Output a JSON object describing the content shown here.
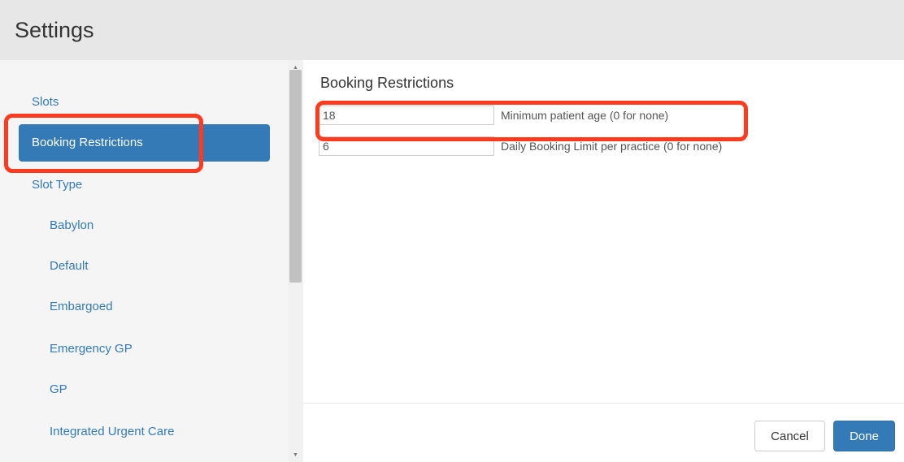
{
  "window": {
    "title": "Settings"
  },
  "sidebar": {
    "items": [
      {
        "label": "Slots"
      },
      {
        "label": "Booking Restrictions"
      },
      {
        "label": "Slot Type"
      },
      {
        "label": "Babylon"
      },
      {
        "label": "Default"
      },
      {
        "label": "Embargoed"
      },
      {
        "label": "Emergency GP"
      },
      {
        "label": "GP"
      },
      {
        "label": "Integrated Urgent Care"
      }
    ],
    "active_item": "Booking Restrictions"
  },
  "main": {
    "section_title": "Booking Restrictions",
    "fields": [
      {
        "value": "18",
        "label": "Minimum patient age (0 for none)"
      },
      {
        "value": "6",
        "label": "Daily Booking Limit per practice (0 for none)"
      }
    ]
  },
  "footer": {
    "cancel_label": "Cancel",
    "done_label": "Done"
  },
  "colors": {
    "accent": "#337ab7",
    "highlight": "#ff3a1f",
    "header_bg": "#e7e7e7",
    "sidebar_bg": "#f5f5f5"
  },
  "icons": {
    "scroll_up": "scroll-up-arrow-icon",
    "scroll_down": "scroll-down-arrow-icon"
  }
}
